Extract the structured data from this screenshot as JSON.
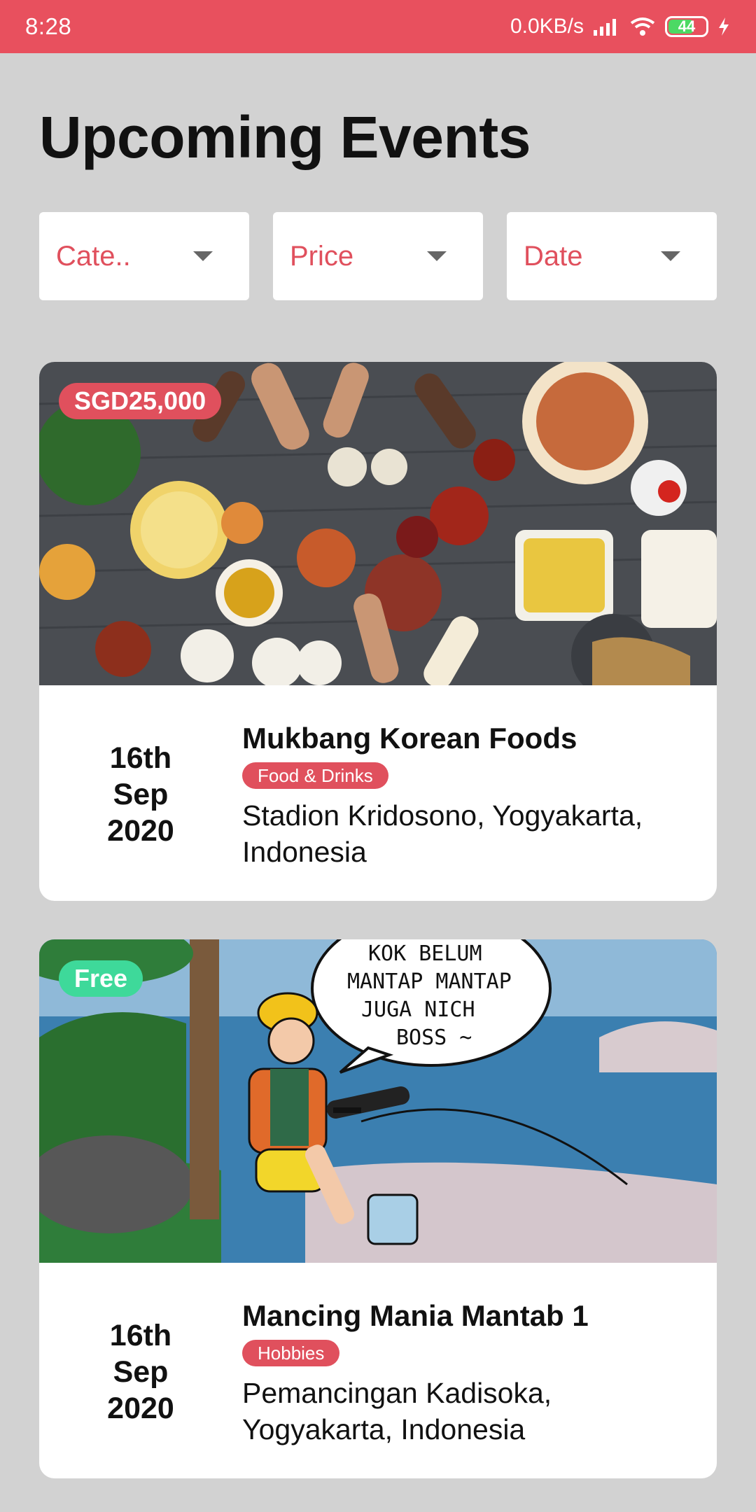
{
  "status_bar": {
    "time": "8:28",
    "network_speed": "0.0KB/s",
    "battery": "44",
    "signal_icon": "signal-icon",
    "wifi_icon": "wifi-icon",
    "charging_icon": "bolt-icon"
  },
  "page": {
    "title": "Upcoming Events"
  },
  "filters": [
    {
      "label": "Cate..",
      "icon": "caret-down-icon"
    },
    {
      "label": "Price",
      "icon": "caret-down-icon"
    },
    {
      "label": "Date",
      "icon": "caret-down-icon"
    }
  ],
  "events": [
    {
      "price": "SGD25,000",
      "price_color": "#e0505d",
      "date_day": "16th",
      "date_month": "Sep",
      "date_year": "2020",
      "name": "Mukbang Korean Foods",
      "category": "Food & Drinks",
      "location": "Stadion Kridosono, Yogyakarta, Indonesia"
    },
    {
      "price": "Free",
      "price_color": "#3ed99a",
      "date_day": "16th",
      "date_month": "Sep",
      "date_year": "2020",
      "name": "Mancing Mania Mantab 1",
      "category": "Hobbies",
      "location": "Pemancingan Kadisoka, Yogyakarta, Indonesia",
      "image_caption": "KOK BELUM MANTAP MANTAP JUGA NICH BOSS ~"
    }
  ],
  "colors": {
    "accent": "#e8505e",
    "background": "#d2d2d2",
    "free_badge": "#3ed99a"
  }
}
